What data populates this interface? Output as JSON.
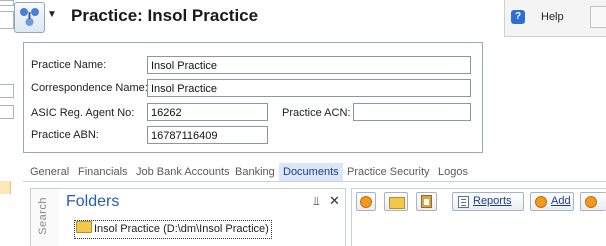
{
  "header": {
    "title": "Practice: Insol Practice",
    "help_label": "Help",
    "help_glyph": "?"
  },
  "form": {
    "practice_name_label": "Practice Name:",
    "practice_name_value": "Insol Practice",
    "correspondence_name_label": "Correspondence Name:",
    "correspondence_name_value": "Insol Practice",
    "asic_label": "ASIC Reg. Agent No:",
    "asic_value": "16262",
    "acn_label": "Practice ACN:",
    "acn_value": "",
    "abn_label": "Practice ABN:",
    "abn_value": "16787116409"
  },
  "tabs": [
    {
      "label": "General"
    },
    {
      "label": "Financials"
    },
    {
      "label": "Job Bank Accounts"
    },
    {
      "label": "Banking"
    },
    {
      "label": "Documents",
      "active": true
    },
    {
      "label": "Practice Security"
    },
    {
      "label": "Logos"
    }
  ],
  "folders": {
    "search_label": "Search",
    "title": "Folders",
    "pin_glyph": "⫫",
    "close_glyph": "✕",
    "tree_item": "Insol Practice (D:\\dm\\Insol Practice)"
  },
  "documents_toolbar": {
    "reports_label": "Reports",
    "add_label": "Add"
  },
  "colors": {
    "accent": "#2a5bb5",
    "active_tab_bg": "#dbe6f6",
    "orange_icon": "#f29a1f"
  },
  "icons": [
    "app-icon",
    "chevron-down-icon",
    "help-icon",
    "pin-icon",
    "close-icon",
    "folder-icon",
    "add-circle-icon",
    "open-folder-icon",
    "clipboard-icon",
    "report-icon"
  ]
}
